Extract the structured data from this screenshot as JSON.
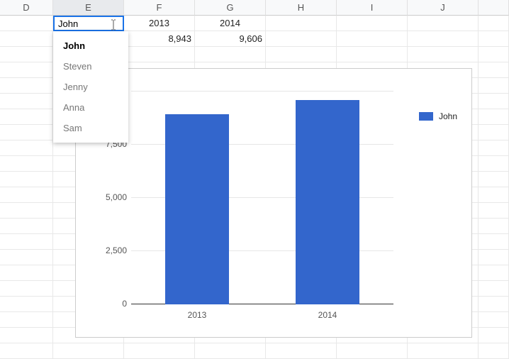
{
  "columns": [
    "D",
    "E",
    "F",
    "G",
    "H",
    "I",
    "J"
  ],
  "selected_column": "E",
  "edit_cell": {
    "value": "John"
  },
  "dropdown": {
    "items": [
      "John",
      "Steven",
      "Jenny",
      "Anna",
      "Sam"
    ],
    "selected_index": 0
  },
  "cells": {
    "F1": "2013",
    "G1": "2014",
    "F2": "8,943",
    "G2": "9,606"
  },
  "chart_data": {
    "type": "bar",
    "categories": [
      "2013",
      "2014"
    ],
    "series": [
      {
        "name": "John",
        "values": [
          8943,
          9606
        ]
      }
    ],
    "ylim": [
      0,
      10000
    ],
    "yticks": [
      0,
      2500,
      5000,
      7500,
      10000
    ],
    "ytick_labels": [
      "0",
      "2,500",
      "5,000",
      "7,500",
      "0"
    ],
    "legend": {
      "position": "right"
    },
    "bar_color": "#3366cc",
    "title": "",
    "xlabel": "",
    "ylabel": ""
  }
}
